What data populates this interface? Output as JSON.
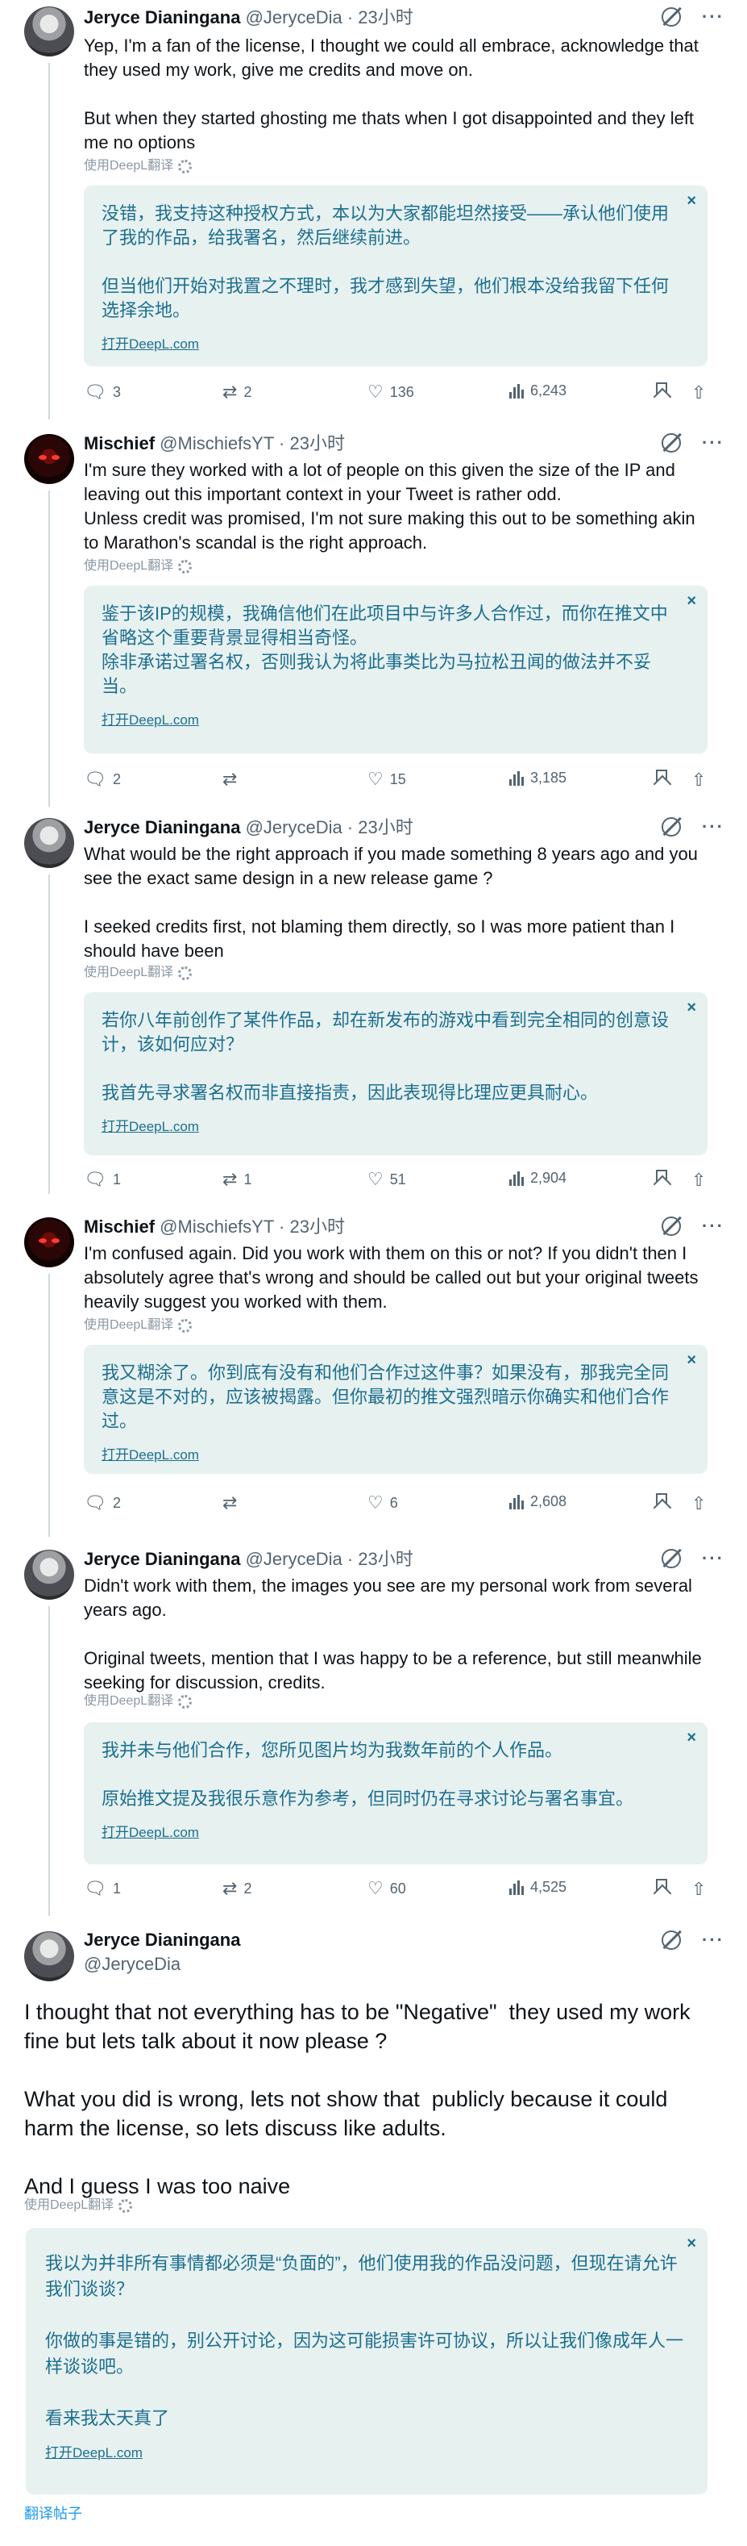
{
  "replies": [
    {
      "author": "Jeryce Dianingana",
      "handle": "@JeryceDia",
      "time": "23小时",
      "body": "Yep, I'm a fan of the license, I thought we could all embrace, acknowledge that they used my work, give me credits and move on.\n\nBut when they started ghosting me thats when I got disappointed and they left me no options",
      "deepl_label": "使用DeepL翻译",
      "translation": "没错，我支持这种授权方式，本以为大家都能坦然接受——承认他们使用了我的作品，给我署名，然后继续前进。\n\n但当他们开始对我置之不理时，我才感到失望，他们根本没给我留下任何选择余地。",
      "open_label": "打开DeepL.com",
      "replies": "3",
      "reposts": "2",
      "likes": "136",
      "views": "6,243"
    },
    {
      "author": "Mischief",
      "handle": "@MischiefsYT",
      "time": "23小时",
      "body": "I'm sure they worked with a lot of people on this given the size of the IP and leaving out this important context in your Tweet is rather odd.\nUnless credit was promised, I'm not sure making this out to be something akin to Marathon's scandal is the right approach.",
      "deepl_label": "使用DeepL翻译",
      "translation": "鉴于该IP的规模，我确信他们在此项目中与许多人合作过，而你在推文中省略这个重要背景显得相当奇怪。\n除非承诺过署名权，否则我认为将此事类比为马拉松丑闻的做法并不妥当。",
      "open_label": "打开DeepL.com",
      "replies": "2",
      "reposts": "",
      "likes": "15",
      "views": "3,185"
    },
    {
      "author": "Jeryce Dianingana",
      "handle": "@JeryceDia",
      "time": "23小时",
      "body": "What would be the right approach if you made something 8 years ago and you see the exact same design in a new release game ?\n\nI seeked credits first, not blaming them directly, so I was more patient than I should have been",
      "deepl_label": "使用DeepL翻译",
      "translation": "若你八年前创作了某件作品，却在新发布的游戏中看到完全相同的创意设计，该如何应对？\n\n我首先寻求署名权而非直接指责，因此表现得比理应更具耐心。",
      "open_label": "打开DeepL.com",
      "replies": "1",
      "reposts": "1",
      "likes": "51",
      "views": "2,904"
    },
    {
      "author": "Mischief",
      "handle": "@MischiefsYT",
      "time": "23小时",
      "body": "I'm confused again. Did you work with them on this or not? If you didn't then I absolutely agree that's wrong and should be called out but your original tweets heavily suggest you worked with them.",
      "deepl_label": "使用DeepL翻译",
      "translation": "我又糊涂了。你到底有没有和他们合作过这件事？如果没有，那我完全同意这是不对的，应该被揭露。但你最初的推文强烈暗示你确实和他们合作过。",
      "open_label": "打开DeepL.com",
      "replies": "2",
      "reposts": "",
      "likes": "6",
      "views": "2,608"
    },
    {
      "author": "Jeryce Dianingana",
      "handle": "@JeryceDia",
      "time": "23小时",
      "body": "Didn't work with them, the images you see are my personal work from several years ago.\n\nOriginal tweets, mention that I was happy to be a reference, but still meanwhile seeking for discussion, credits.",
      "deepl_label": "使用DeepL翻译",
      "translation": "我并未与他们合作，您所见图片均为我数年前的个人作品。\n\n原始推文提及我很乐意作为参考，但同时仍在寻求讨论与署名事宜。",
      "open_label": "打开DeepL.com",
      "replies": "1",
      "reposts": "2",
      "likes": "60",
      "views": "4,525"
    }
  ],
  "main": {
    "author": "Jeryce Dianingana",
    "handle": "@JeryceDia",
    "body": "I thought that not everything has to be \"Negative\"  they used my work fine but lets talk about it now please ?\n\nWhat you did is wrong, lets not show that  publicly because it could harm the license, so lets discuss like adults.\n\nAnd I guess I was too naive",
    "deepl_label": "使用DeepL翻译",
    "translation": "我以为并非所有事情都必须是“负面的”，他们使用我的作品没问题，但现在请允许我们谈谈？\n\n你做的事是错的，别公开讨论，因为这可能损害许可协议，所以让我们像成年人一样谈谈吧。\n\n看来我太天真了",
    "open_label": "打开DeepL.com",
    "translate_post": "翻译帖子"
  },
  "icons": {
    "more": "···",
    "close": "×",
    "reply": "reply-icon",
    "repost": "repost-icon",
    "like": "heart-icon",
    "views": "views-icon",
    "bookmark": "bookmark-icon",
    "share": "share-icon"
  },
  "colors": {
    "translation_bg": "#e7f1f0",
    "translation_text": "#1d6f8f",
    "link": "#1d9bf0",
    "muted": "#536471"
  }
}
